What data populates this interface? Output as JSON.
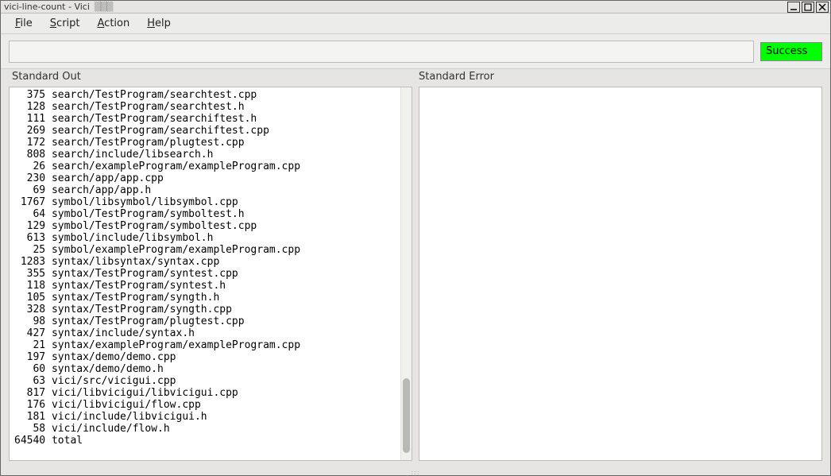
{
  "window": {
    "title": "vici-line-count - Vici"
  },
  "menu": {
    "file": "File",
    "script": "Script",
    "action": "Action",
    "help": "Help"
  },
  "toolbar": {
    "command_value": "",
    "command_placeholder": "",
    "status_label": "Success"
  },
  "labels": {
    "stdout": "Standard Out",
    "stderr": "Standard Error"
  },
  "stdout_lines": [
    {
      "count": 375,
      "path": "search/TestProgram/searchtest.cpp"
    },
    {
      "count": 128,
      "path": "search/TestProgram/searchtest.h"
    },
    {
      "count": 111,
      "path": "search/TestProgram/searchiftest.h"
    },
    {
      "count": 269,
      "path": "search/TestProgram/searchiftest.cpp"
    },
    {
      "count": 172,
      "path": "search/TestProgram/plugtest.cpp"
    },
    {
      "count": 808,
      "path": "search/include/libsearch.h"
    },
    {
      "count": 26,
      "path": "search/exampleProgram/exampleProgram.cpp"
    },
    {
      "count": 230,
      "path": "search/app/app.cpp"
    },
    {
      "count": 69,
      "path": "search/app/app.h"
    },
    {
      "count": 1767,
      "path": "symbol/libsymbol/libsymbol.cpp"
    },
    {
      "count": 64,
      "path": "symbol/TestProgram/symboltest.h"
    },
    {
      "count": 129,
      "path": "symbol/TestProgram/symboltest.cpp"
    },
    {
      "count": 613,
      "path": "symbol/include/libsymbol.h"
    },
    {
      "count": 25,
      "path": "symbol/exampleProgram/exampleProgram.cpp"
    },
    {
      "count": 1283,
      "path": "syntax/libsyntax/syntax.cpp"
    },
    {
      "count": 355,
      "path": "syntax/TestProgram/syntest.cpp"
    },
    {
      "count": 118,
      "path": "syntax/TestProgram/syntest.h"
    },
    {
      "count": 105,
      "path": "syntax/TestProgram/syngth.h"
    },
    {
      "count": 328,
      "path": "syntax/TestProgram/syngth.cpp"
    },
    {
      "count": 98,
      "path": "syntax/TestProgram/plugtest.cpp"
    },
    {
      "count": 427,
      "path": "syntax/include/syntax.h"
    },
    {
      "count": 21,
      "path": "syntax/exampleProgram/exampleProgram.cpp"
    },
    {
      "count": 197,
      "path": "syntax/demo/demo.cpp"
    },
    {
      "count": 60,
      "path": "syntax/demo/demo.h"
    },
    {
      "count": 63,
      "path": "vici/src/vicigui.cpp"
    },
    {
      "count": 817,
      "path": "vici/libvicigui/libvicigui.cpp"
    },
    {
      "count": 176,
      "path": "vici/libvicigui/flow.cpp"
    },
    {
      "count": 181,
      "path": "vici/include/libvicigui.h"
    },
    {
      "count": 58,
      "path": "vici/include/flow.h"
    },
    {
      "count": 64540,
      "path": "total"
    }
  ],
  "stderr_text": ""
}
